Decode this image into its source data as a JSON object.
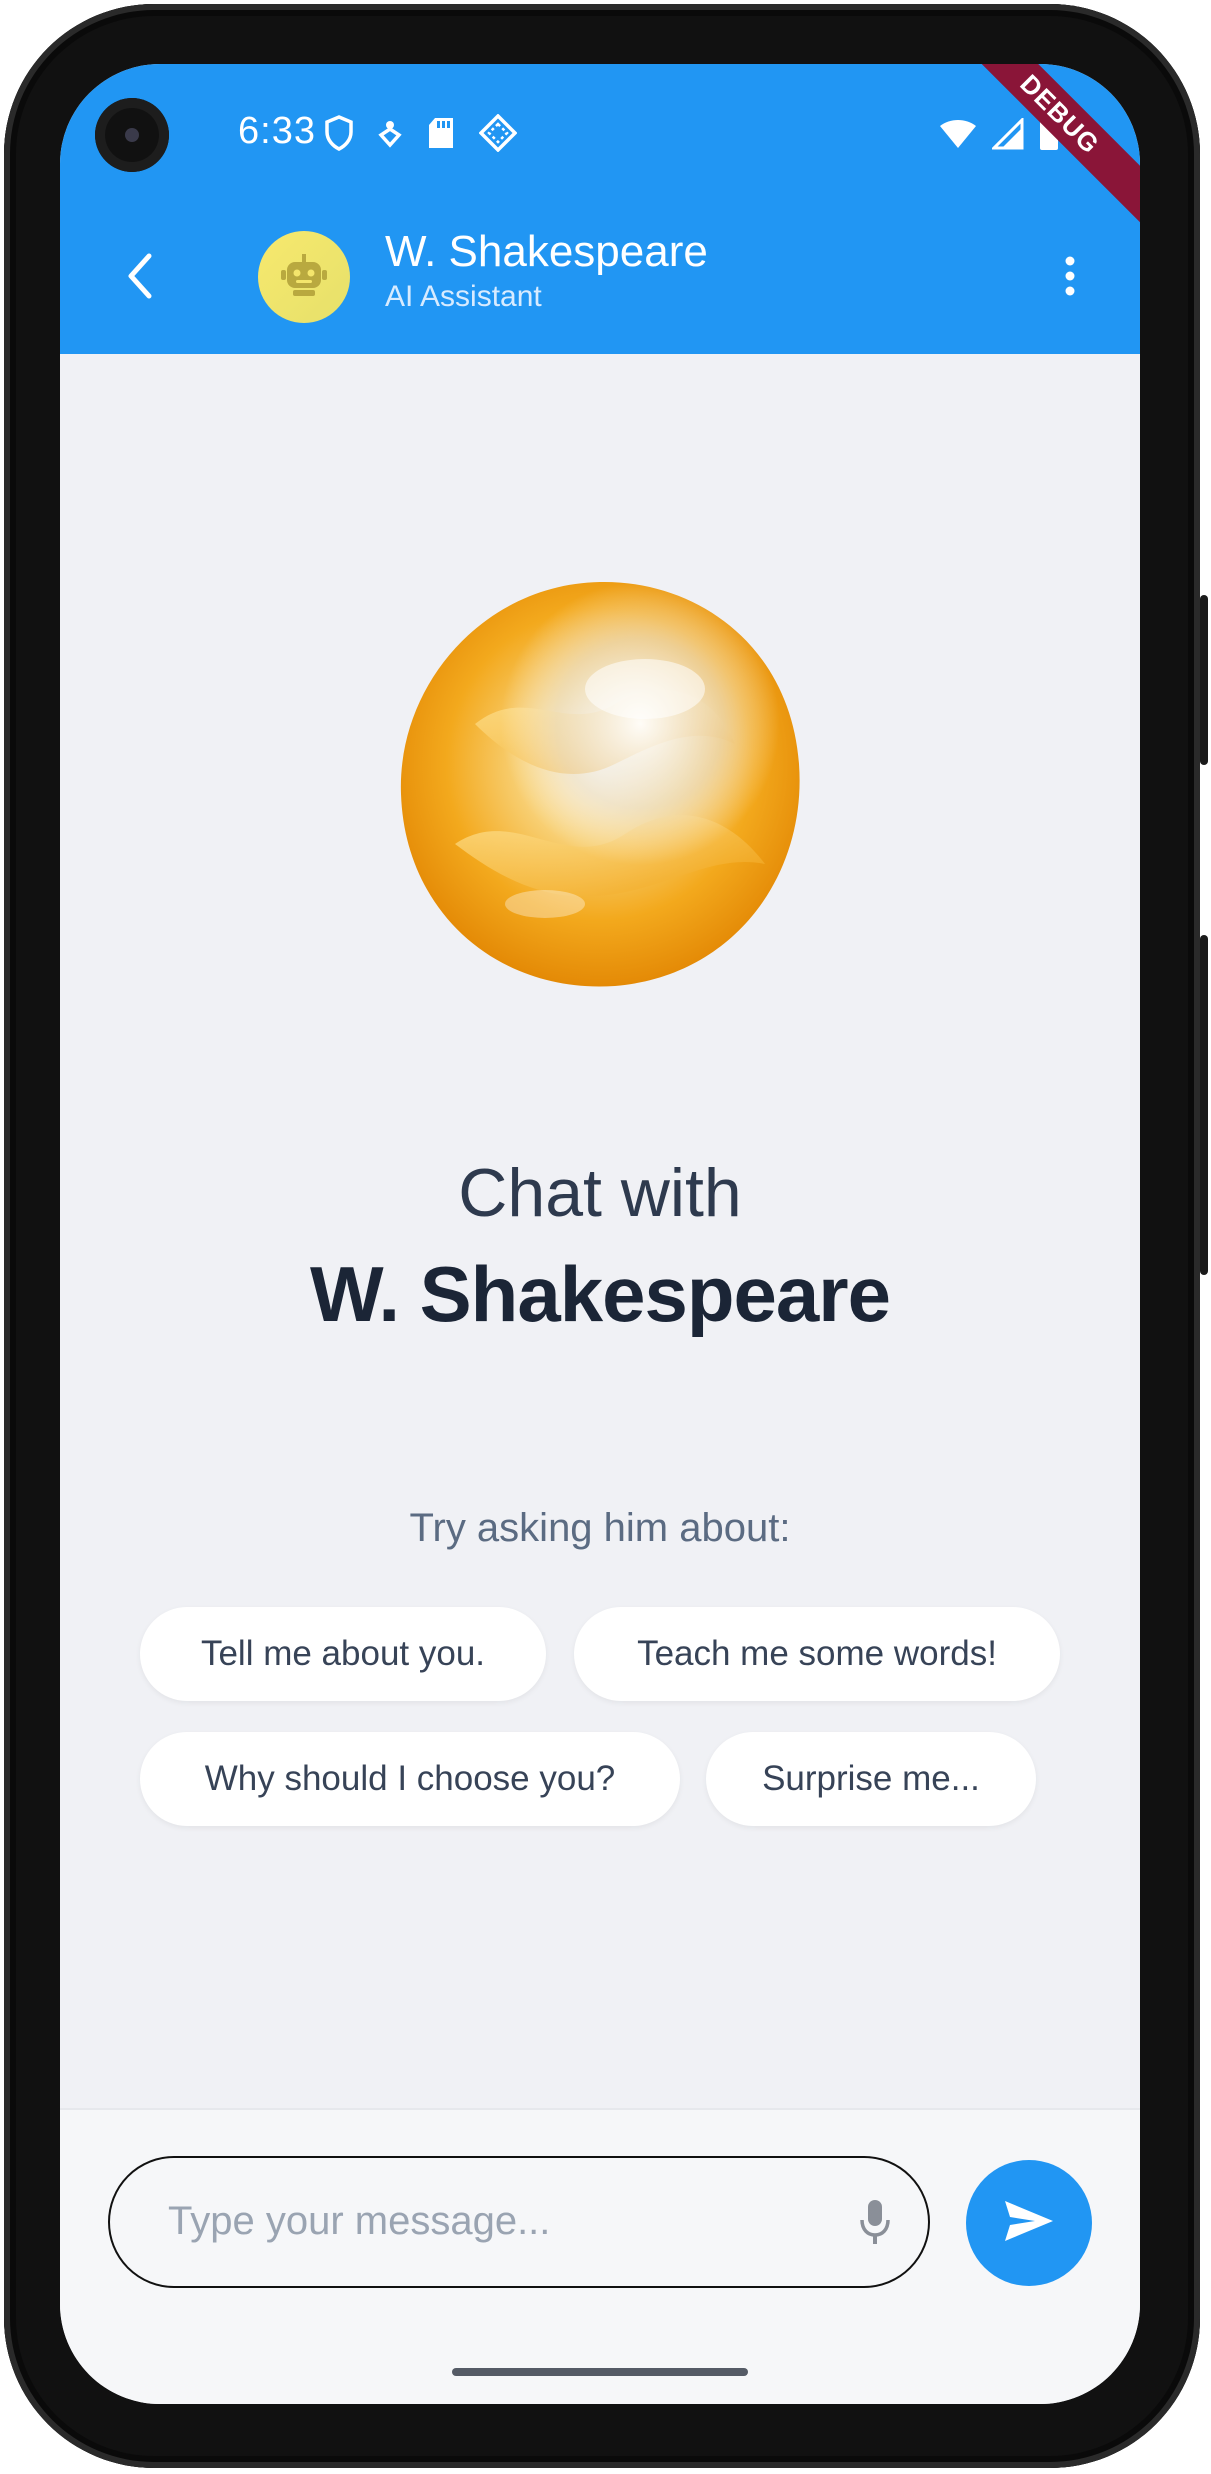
{
  "status_bar": {
    "time": "6:33",
    "left_icons": [
      "shield-icon",
      "location-tag-icon",
      "sd-card-icon",
      "cast-diamond-icon"
    ],
    "right_icons": [
      "wifi-icon",
      "cell-signal-icon",
      "battery-icon"
    ],
    "debug_banner": "DEBUG"
  },
  "app_bar": {
    "title": "W. Shakespeare",
    "subtitle": "AI Assistant",
    "back_icon": "back-arrow-icon",
    "avatar_icon": "robot-icon",
    "menu_icon": "more-vert-icon",
    "colors": {
      "primary": "#2196f3",
      "avatar_bg": "#f2e46c"
    }
  },
  "main": {
    "chat_with_label": "Chat with",
    "assistant_name": "W. Shakespeare",
    "suggestions_heading": "Try asking him about:",
    "suggestions": [
      "Tell me about you.",
      "Teach me some words!",
      "Why should I choose you?",
      "Surprise me..."
    ]
  },
  "composer": {
    "placeholder": "Type your message...",
    "value": "",
    "mic_icon": "microphone-icon",
    "send_icon": "send-icon"
  }
}
